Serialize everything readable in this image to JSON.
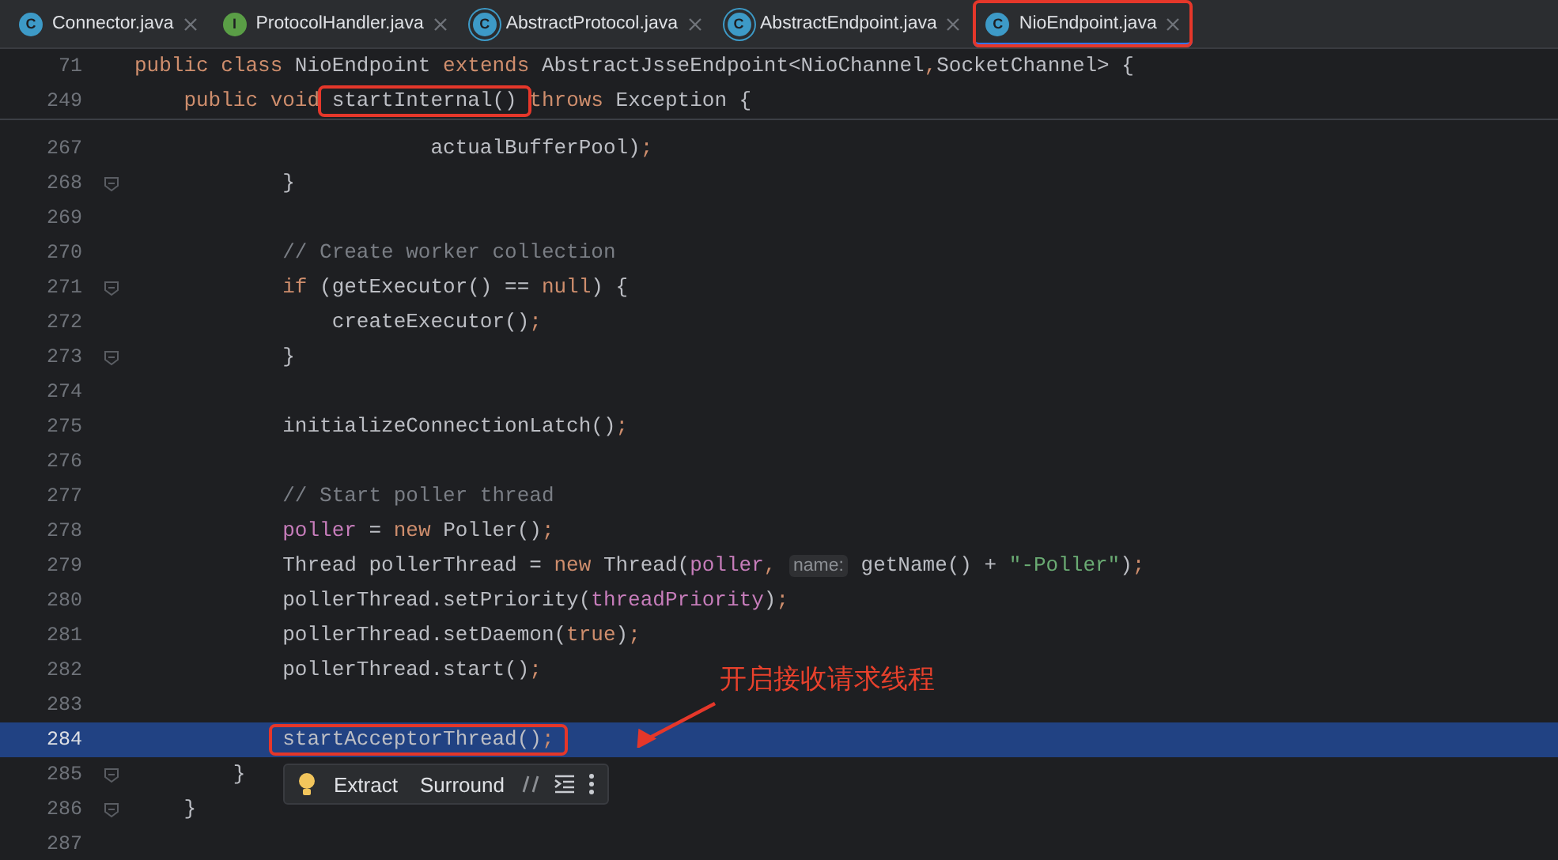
{
  "tabs": [
    {
      "label": "Connector.java",
      "kind": "class",
      "badge": "C",
      "selected": false,
      "boxed": false
    },
    {
      "label": "ProtocolHandler.java",
      "kind": "interface",
      "badge": "I",
      "selected": false,
      "boxed": false
    },
    {
      "label": "AbstractProtocol.java",
      "kind": "abstract",
      "badge": "C",
      "selected": false,
      "boxed": false
    },
    {
      "label": "AbstractEndpoint.java",
      "kind": "abstract",
      "badge": "C",
      "selected": false,
      "boxed": false
    },
    {
      "label": "NioEndpoint.java",
      "kind": "class",
      "badge": "C",
      "selected": true,
      "boxed": true
    }
  ],
  "sticky_lines": [
    {
      "number": "71",
      "tokens": [
        {
          "kind": "kw",
          "t": "public class "
        },
        {
          "kind": "plain",
          "t": "NioEndpoint "
        },
        {
          "kind": "kw",
          "t": "extends "
        },
        {
          "kind": "plain",
          "t": "AbstractJsseEndpoint<NioChannel"
        },
        {
          "kind": "punct",
          "t": ","
        },
        {
          "kind": "plain",
          "t": "SocketChannel> {"
        }
      ]
    },
    {
      "number": "249",
      "tokens": [
        {
          "kind": "kw",
          "t": "    public void "
        },
        {
          "kind": "plain",
          "t": "startInternal()",
          "boxed": true
        },
        {
          "kind": "kw",
          "t": " throws "
        },
        {
          "kind": "plain",
          "t": "Exception {"
        }
      ]
    }
  ],
  "lines": [
    {
      "number": "267",
      "fold": false,
      "highlighted": false,
      "tokens": [
        {
          "kind": "plain",
          "t": "                        actualBufferPool)"
        },
        {
          "kind": "punct",
          "t": ";"
        }
      ]
    },
    {
      "number": "268",
      "fold": true,
      "highlighted": false,
      "tokens": [
        {
          "kind": "plain",
          "t": "            }"
        }
      ]
    },
    {
      "number": "269",
      "fold": false,
      "highlighted": false
    },
    {
      "number": "270",
      "fold": false,
      "highlighted": false,
      "tokens": [
        {
          "kind": "comment",
          "t": "            // Create worker collection"
        }
      ]
    },
    {
      "number": "271",
      "fold": true,
      "highlighted": false,
      "tokens": [
        {
          "kind": "kw",
          "t": "            if"
        },
        {
          "kind": "plain",
          "t": " (getExecutor() == "
        },
        {
          "kind": "kw",
          "t": "null"
        },
        {
          "kind": "plain",
          "t": ") {"
        }
      ]
    },
    {
      "number": "272",
      "fold": false,
      "highlighted": false,
      "tokens": [
        {
          "kind": "plain",
          "t": "                createExecutor()"
        },
        {
          "kind": "punct",
          "t": ";"
        }
      ]
    },
    {
      "number": "273",
      "fold": true,
      "highlighted": false,
      "tokens": [
        {
          "kind": "plain",
          "t": "            }"
        }
      ]
    },
    {
      "number": "274",
      "fold": false,
      "highlighted": false
    },
    {
      "number": "275",
      "fold": false,
      "highlighted": false,
      "tokens": [
        {
          "kind": "plain",
          "t": "            initializeConnectionLatch()"
        },
        {
          "kind": "punct",
          "t": ";"
        }
      ]
    },
    {
      "number": "276",
      "fold": false,
      "highlighted": false
    },
    {
      "number": "277",
      "fold": false,
      "highlighted": false,
      "tokens": [
        {
          "kind": "comment",
          "t": "            // Start poller thread"
        }
      ]
    },
    {
      "number": "278",
      "fold": false,
      "highlighted": false,
      "tokens": [
        {
          "kind": "field",
          "t": "            poller"
        },
        {
          "kind": "plain",
          "t": " = "
        },
        {
          "kind": "kw",
          "t": "new "
        },
        {
          "kind": "plain",
          "t": "Poller()"
        },
        {
          "kind": "punct",
          "t": ";"
        }
      ]
    },
    {
      "number": "279",
      "fold": false,
      "highlighted": false,
      "tokens": [
        {
          "kind": "plain",
          "t": "            Thread pollerThread = "
        },
        {
          "kind": "kw",
          "t": "new "
        },
        {
          "kind": "plain",
          "t": "Thread("
        },
        {
          "kind": "field",
          "t": "poller"
        },
        {
          "kind": "punct",
          "t": ", "
        },
        {
          "kind": "hint",
          "t": "name:"
        },
        {
          "kind": "plain",
          "t": " getName() + "
        },
        {
          "kind": "str",
          "t": "\"-Poller\""
        },
        {
          "kind": "plain",
          "t": ")"
        },
        {
          "kind": "punct",
          "t": ";"
        }
      ]
    },
    {
      "number": "280",
      "fold": false,
      "highlighted": false,
      "tokens": [
        {
          "kind": "plain",
          "t": "            pollerThread.setPriority("
        },
        {
          "kind": "field",
          "t": "threadPriority"
        },
        {
          "kind": "plain",
          "t": ")"
        },
        {
          "kind": "punct",
          "t": ";"
        }
      ]
    },
    {
      "number": "281",
      "fold": false,
      "highlighted": false,
      "tokens": [
        {
          "kind": "plain",
          "t": "            pollerThread.setDaemon("
        },
        {
          "kind": "kw",
          "t": "true"
        },
        {
          "kind": "plain",
          "t": ")"
        },
        {
          "kind": "punct",
          "t": ";"
        }
      ]
    },
    {
      "number": "282",
      "fold": false,
      "highlighted": false,
      "tokens": [
        {
          "kind": "plain",
          "t": "            pollerThread.start()"
        },
        {
          "kind": "punct",
          "t": ";"
        }
      ]
    },
    {
      "number": "283",
      "fold": false,
      "highlighted": false
    },
    {
      "number": "284",
      "fold": false,
      "highlighted": true,
      "tokens": [
        {
          "kind": "plain",
          "t": "            startAcceptorThread()",
          "boxed": true
        },
        {
          "kind": "punct",
          "t": ";",
          "boxed": true
        }
      ]
    },
    {
      "number": "285",
      "fold": true,
      "highlighted": false,
      "tokens": [
        {
          "kind": "plain",
          "t": "        }"
        }
      ]
    },
    {
      "number": "286",
      "fold": true,
      "highlighted": false,
      "tokens": [
        {
          "kind": "plain",
          "t": "    }"
        }
      ]
    },
    {
      "number": "287",
      "fold": false,
      "highlighted": false
    }
  ],
  "annotation": {
    "text": "开启接收请求线程"
  },
  "intention_popup": {
    "actions": [
      "Extract",
      "Surround"
    ]
  }
}
